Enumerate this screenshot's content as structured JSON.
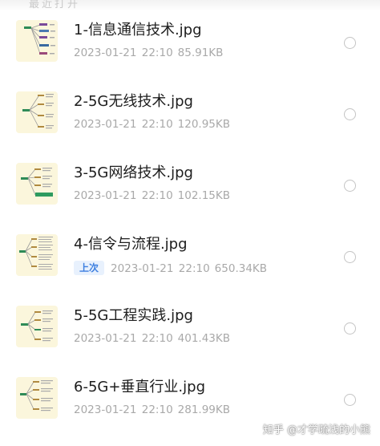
{
  "files": [
    {
      "name": "1-信息通信技术.jpg",
      "tag": "",
      "date": "2023-01-21 22:10",
      "size": "85.91KB"
    },
    {
      "name": "2-5G无线技术.jpg",
      "tag": "",
      "date": "2023-01-21 22:10",
      "size": "120.95KB"
    },
    {
      "name": "3-5G网络技术.jpg",
      "tag": "",
      "date": "2023-01-21 22:10",
      "size": "102.15KB"
    },
    {
      "name": "4-信令与流程.jpg",
      "tag": "上次",
      "date": "2023-01-21 22:10",
      "size": "650.34KB"
    },
    {
      "name": "5-5G工程实践.jpg",
      "tag": "",
      "date": "2023-01-21 22:10",
      "size": "401.43KB"
    },
    {
      "name": "6-5G+垂直行业.jpg",
      "tag": "",
      "date": "2023-01-21 22:10",
      "size": "281.99KB"
    }
  ],
  "header_partial": "最近打开",
  "watermark": "知乎 @才学疏浅的小熊",
  "colors": {
    "accent": "#3d7fe0",
    "thumb_bg": "#fbf6dc",
    "mindmap_green": "#2e8b57"
  },
  "icons": {
    "thumbnail": "mindmap-thumbnail-icon",
    "select": "radio-button-icon"
  }
}
